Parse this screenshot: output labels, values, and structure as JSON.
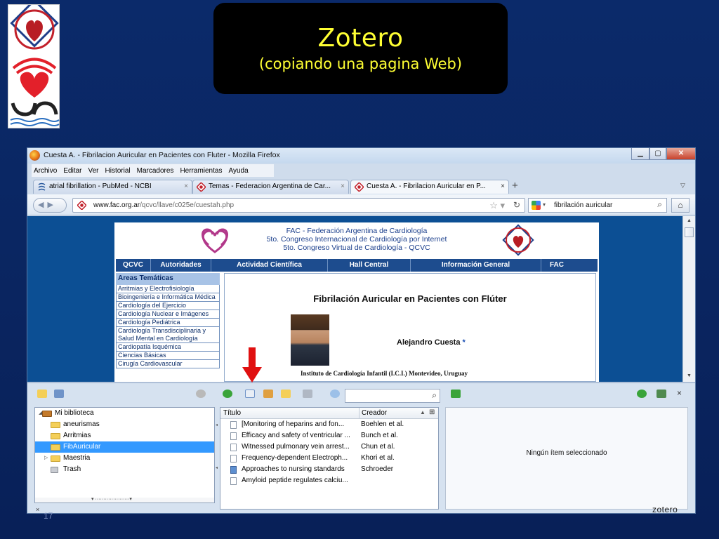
{
  "slide": {
    "title": "Zotero",
    "subtitle": "(copiando una pagina Web)",
    "number": "17"
  },
  "browser": {
    "window_title": "Cuesta A. - Fibrilacion Auricular en Pacientes con Fluter - Mozilla Firefox",
    "menu": [
      "Archivo",
      "Editar",
      "Ver",
      "Historial",
      "Marcadores",
      "Herramientas",
      "Ayuda"
    ],
    "tabs": [
      {
        "label": "atrial fibrillation - PubMed - NCBI",
        "active": false
      },
      {
        "label": "Temas - Federacion Argentina de Car...",
        "active": false
      },
      {
        "label": "Cuesta A. - Fibrilacion Auricular en P...",
        "active": true
      }
    ],
    "url_domain": "www.fac.org.ar",
    "url_path": "/qcvc/llave/c025e/cuestah.php",
    "search_value": "fibrilación auricular"
  },
  "webpage": {
    "header_lines": [
      "FAC - Federación Argentina de Cardiología",
      "5to. Congreso Internacional de Cardiología por Internet",
      "5to. Congreso Virtual de Cardiología - QCVC"
    ],
    "nav": [
      "QCVC",
      "Autoridades",
      "Actividad Científica",
      "Hall Central",
      "Información General",
      "FAC"
    ],
    "sidebar_header": "Areas Temáticas",
    "sidebar_items": [
      "Arritmias y Electrofisiología",
      "Bioingeniería e Informática Médica",
      "Cardiología del Ejercicio",
      "Cardiología Nuclear e Imágenes",
      "Cardiología Pediátrica",
      "Cardiología Transdisciplinaria y Salud Mental en Cardiología",
      "Cardiopatía Isquémica",
      "Ciencias Básicas",
      "Cirugía Cardiovascular"
    ],
    "article_title": "Fibrilación Auricular en Pacientes con Flúter",
    "author": "Alejandro Cuesta",
    "author_marker": "*",
    "institution": "Instituto de Cardiología Infantil (I.C.I.) Montevideo, Uruguay"
  },
  "zotero": {
    "collections": [
      {
        "label": "Mi biblioteca",
        "level": 0,
        "selected": false,
        "twisty": "◢"
      },
      {
        "label": "aneurismas",
        "level": 1,
        "selected": false,
        "twisty": ""
      },
      {
        "label": "Arritmias",
        "level": 1,
        "selected": false,
        "twisty": ""
      },
      {
        "label": "FibAuricular",
        "level": 1,
        "selected": true,
        "twisty": ""
      },
      {
        "label": "Maestria",
        "level": 1,
        "selected": false,
        "twisty": "▷"
      },
      {
        "label": "Trash",
        "level": 1,
        "selected": false,
        "twisty": ""
      }
    ],
    "columns": {
      "title": "Título",
      "creator": "Creador"
    },
    "items": [
      {
        "title": "[Monitoring of heparins and fon...",
        "creator": "Boehlen et al.",
        "icon": "document-icon"
      },
      {
        "title": "Efficacy and safety of ventricular ...",
        "creator": "Bunch et al.",
        "icon": "document-icon"
      },
      {
        "title": "Witnessed pulmonary vein arrest...",
        "creator": "Chun et al.",
        "icon": "document-icon"
      },
      {
        "title": "Frequency-dependent Electroph...",
        "creator": "Khori et al.",
        "icon": "document-icon"
      },
      {
        "title": "Approaches to nursing standards",
        "creator": "Schroeder",
        "icon": "book-icon"
      },
      {
        "title": "Amyloid peptide regulates calciu...",
        "creator": "",
        "icon": "document-icon"
      }
    ],
    "no_selection": "Ningún ítem seleccionado",
    "logo": "zotero"
  },
  "colors": {
    "slide_bg": "#0a2560",
    "title_text": "#ffff33",
    "fac_nav": "#1d4c8e",
    "selection": "#3399ff",
    "arrow": "#e01010"
  }
}
